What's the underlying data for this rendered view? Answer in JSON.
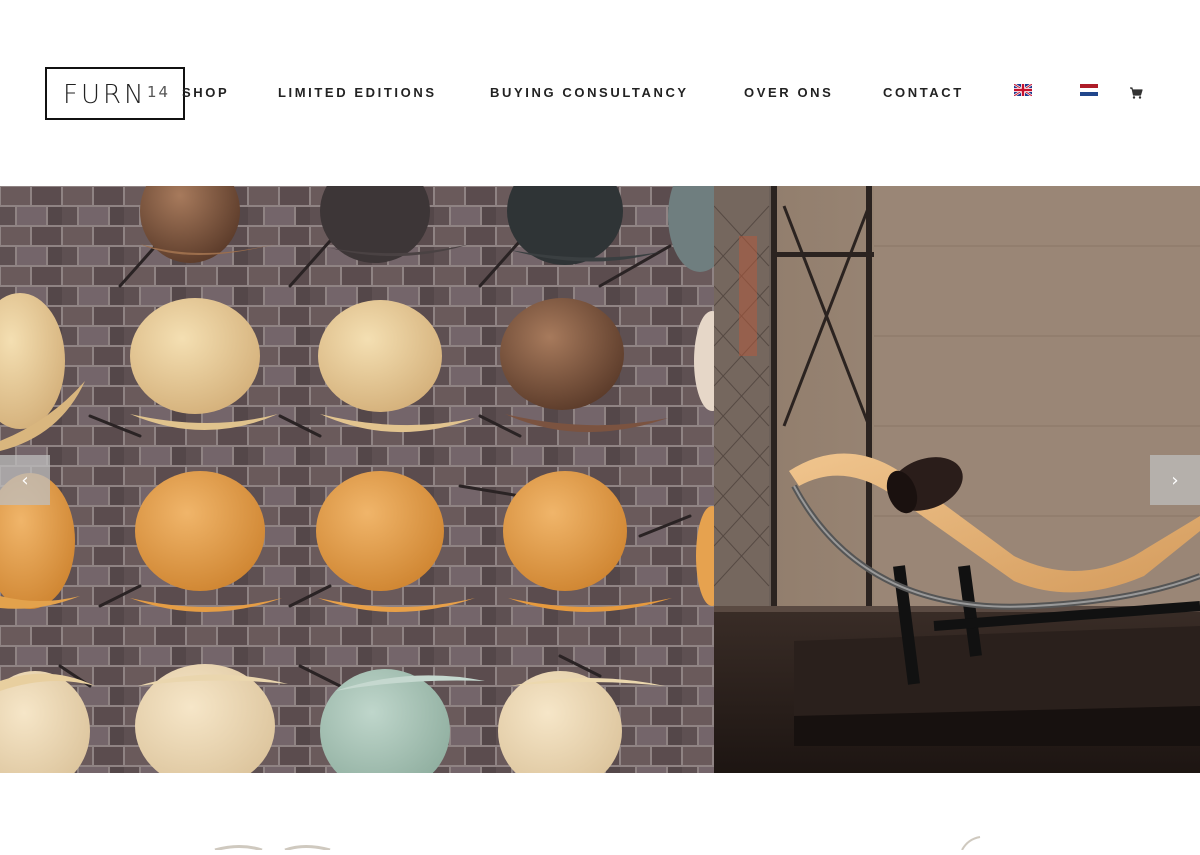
{
  "logo": {
    "name": "FURN",
    "number": "14"
  },
  "nav": {
    "items": [
      {
        "label": "SHOP"
      },
      {
        "label": "LIMITED EDITIONS"
      },
      {
        "label": "BUYING CONSULTANCY"
      },
      {
        "label": "OVER ONS"
      },
      {
        "label": "CONTACT"
      }
    ]
  },
  "languages": [
    {
      "icon": "flag-uk-icon"
    },
    {
      "icon": "flag-nl-icon"
    }
  ],
  "cart": {
    "icon": "cart-icon"
  },
  "slider": {
    "prev_symbol": "‹",
    "next_symbol": "›",
    "slides": [
      {
        "subject": "wall of ant chairs on brick wall"
      },
      {
        "subject": "chaise longue lounge chair"
      }
    ]
  },
  "colors": {
    "text": "#222222",
    "arrow_bg": "#bebebe",
    "brick": "#5e4e4c"
  }
}
